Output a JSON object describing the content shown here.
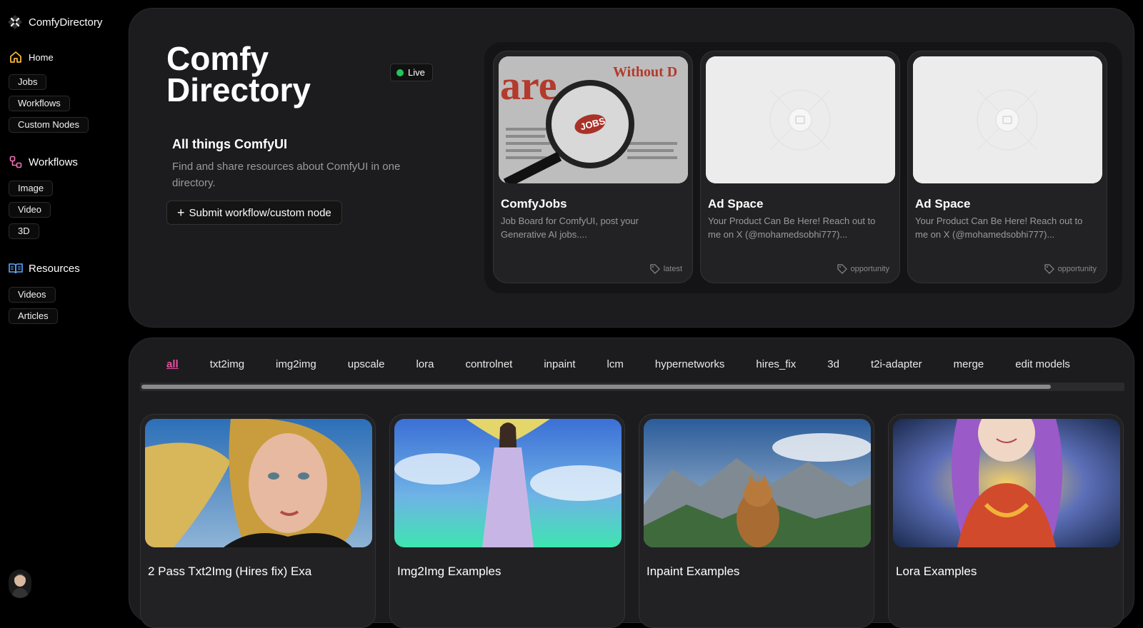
{
  "brand": {
    "name": "ComfyDirectory"
  },
  "sidebar": {
    "home": "Home",
    "home_chips": [
      "Jobs",
      "Workflows",
      "Custom Nodes"
    ],
    "workflows": "Workflows",
    "workflow_chips": [
      "Image",
      "Video",
      "3D"
    ],
    "resources": "Resources",
    "resource_chips": [
      "Videos",
      "Articles"
    ]
  },
  "hero": {
    "title": "Comfy Directory",
    "live": "Live",
    "tagline": "All things ComfyUI",
    "description": "Find and share resources about ComfyUI in one directory.",
    "submit": "Submit workflow/custom node"
  },
  "promos": [
    {
      "title": "ComfyJobs",
      "subtitle": "Job Board for ComfyUI, post your Generative AI jobs....",
      "tag": "latest"
    },
    {
      "title": "Ad Space",
      "subtitle": "Your Product Can Be Here! Reach out to me on X (@mohamedsobhi777)...",
      "tag": "opportunity"
    },
    {
      "title": "Ad Space",
      "subtitle": "Your Product Can Be Here! Reach out to me on X (@mohamedsobhi777)...",
      "tag": "opportunity"
    }
  ],
  "tabs": [
    "all",
    "txt2img",
    "img2img",
    "upscale",
    "lora",
    "controlnet",
    "inpaint",
    "lcm",
    "hypernetworks",
    "hires_fix",
    "3d",
    "t2i-adapter",
    "merge",
    "edit models"
  ],
  "active_tab": "all",
  "workflows": [
    {
      "title": "2 Pass Txt2Img (Hires fix) Exa"
    },
    {
      "title": "Img2Img Examples"
    },
    {
      "title": "Inpaint Examples"
    },
    {
      "title": "Lora Examples"
    }
  ],
  "colors": {
    "accent": "#e94fa1",
    "live": "#22c55e",
    "home_icon": "#f5b73b",
    "workflow_icon": "#f472b6",
    "resources_icon": "#60a5fa"
  }
}
